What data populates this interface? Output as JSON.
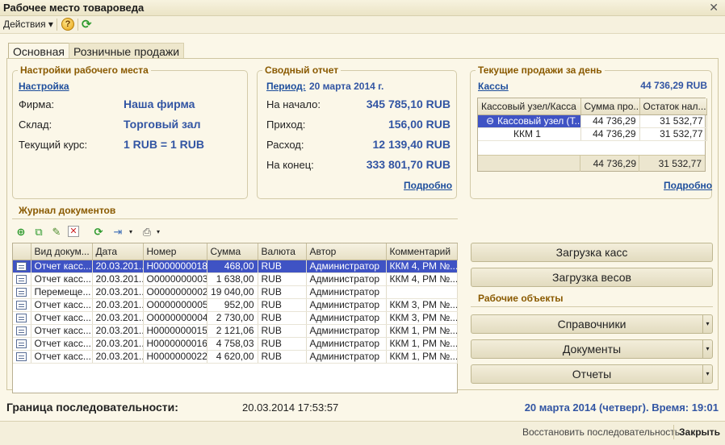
{
  "window": {
    "title": "Рабочее место товароведа"
  },
  "toolbar": {
    "actions_label": "Действия",
    "help_label": "?"
  },
  "tabs": [
    {
      "label": "Основная"
    },
    {
      "label": "Розничные продажи"
    }
  ],
  "settings": {
    "title": "Настройки рабочего места",
    "link": "Настройка",
    "firm_label": "Фирма:",
    "firm_value": "Наша фирма",
    "warehouse_label": "Склад:",
    "warehouse_value": "Торговый зал",
    "rate_label": "Текущий курс:",
    "rate_value": "1 RUB = 1 RUB"
  },
  "report": {
    "title": "Сводный отчет",
    "period_link": "Период:",
    "period_value": "20 марта 2014 г.",
    "rows": [
      {
        "label": "На начало:",
        "value": "345 785,10 RUB"
      },
      {
        "label": "Приход:",
        "value": "156,00 RUB"
      },
      {
        "label": "Расход:",
        "value": "12 139,40 RUB"
      },
      {
        "label": "На конец:",
        "value": "333 801,70 RUB"
      }
    ],
    "details_link": "Подробно"
  },
  "sales": {
    "title": "Текущие продажи за день",
    "kassy_link": "Кассы",
    "total": "44 736,29 RUB",
    "columns": [
      "Кассовый узел/Касса",
      "Сумма про...",
      "Остаток нал..."
    ],
    "rows": [
      {
        "name": "Кассовый узел (Т...",
        "sum": "44 736,29",
        "rest": "31 532,77",
        "tree_sign": "⊖"
      },
      {
        "name": "ККМ 1",
        "sum": "44 736,29",
        "rest": "31 532,77"
      }
    ],
    "totals": {
      "sum": "44 736,29",
      "rest": "31 532,77"
    },
    "details_link": "Подробно"
  },
  "journal": {
    "title": "Журнал документов",
    "columns": [
      "Вид докум...",
      "Дата",
      "Номер",
      "Сумма",
      "Валюта",
      "Автор",
      "Комментарий"
    ],
    "rows": [
      [
        "Отчет касс...",
        "20.03.201...",
        "Н0000000018",
        "468,00",
        "RUB",
        "Администратор",
        "ККМ 4, РМ №..."
      ],
      [
        "Отчет касс...",
        "20.03.201...",
        "О0000000003",
        "1 638,00",
        "RUB",
        "Администратор",
        "ККМ 4, РМ №..."
      ],
      [
        "Перемеще...",
        "20.03.201...",
        "О0000000002",
        "19 040,00",
        "RUB",
        "Администратор",
        ""
      ],
      [
        "Отчет касс...",
        "20.03.201...",
        "О0000000005",
        "952,00",
        "RUB",
        "Администратор",
        "ККМ 3, РМ №..."
      ],
      [
        "Отчет касс...",
        "20.03.201...",
        "О0000000004",
        "2 730,00",
        "RUB",
        "Администратор",
        "ККМ 3, РМ №..."
      ],
      [
        "Отчет касс...",
        "20.03.201...",
        "Н0000000015",
        "2 121,06",
        "RUB",
        "Администратор",
        "ККМ 1, РМ №..."
      ],
      [
        "Отчет касс...",
        "20.03.201...",
        "Н0000000016",
        "4 758,03",
        "RUB",
        "Администратор",
        "ККМ 1, РМ №..."
      ],
      [
        "Отчет касс...",
        "20.03.201...",
        "Н0000000022",
        "4 620,00",
        "RUB",
        "Администратор",
        "ККМ 1, РМ №..."
      ]
    ]
  },
  "right_panel": {
    "load_cash_button": "Загрузка касс",
    "load_scales_button": "Загрузка весов",
    "work_objects_title": "Рабочие объекты",
    "references_button": "Справочники",
    "documents_button": "Документы",
    "reports_button": "Отчеты"
  },
  "status": {
    "sequence_label": "Граница последовательности:",
    "sequence_value": "20.03.2014 17:53:57",
    "date_time": "20 марта 2014 (четверг). Время: 19:01"
  },
  "footer": {
    "restore_button": "Восстановить последовательность",
    "close_button": "Закрыть"
  },
  "colors": {
    "accent_blue": "#3255a3",
    "group_title": "#8a5a00",
    "selection": "#3f53c4"
  }
}
